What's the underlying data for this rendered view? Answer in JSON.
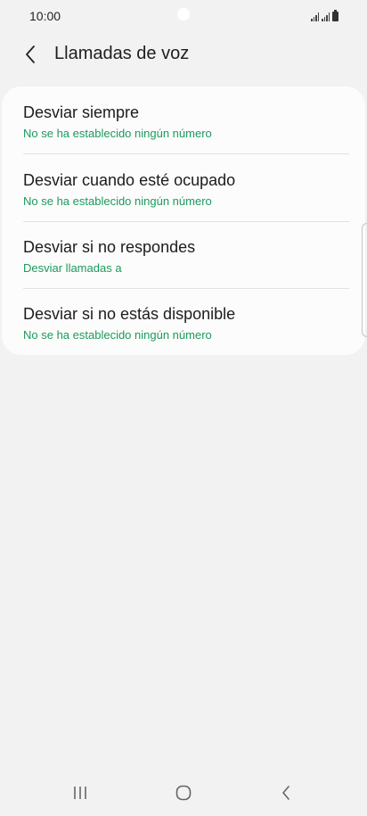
{
  "status_bar": {
    "time": "10:00"
  },
  "header": {
    "title": "Llamadas de voz",
    "back_icon": "chevron-left-icon"
  },
  "settings": {
    "items": [
      {
        "title": "Desviar siempre",
        "subtitle": "No se ha establecido ningún número"
      },
      {
        "title": "Desviar cuando esté ocupado",
        "subtitle": "No se ha establecido ningún número"
      },
      {
        "title": "Desviar si no respondes",
        "subtitle": "Desviar llamadas a"
      },
      {
        "title": "Desviar si no estás disponible",
        "subtitle": "No se ha establecido ningún número"
      }
    ]
  },
  "nav_bar": {
    "recents_icon": "recents-icon",
    "home_icon": "home-icon",
    "back_icon": "back-icon"
  },
  "colors": {
    "accent": "#1c9a5c",
    "background": "#f2f2f2",
    "card": "#fcfcfc"
  }
}
